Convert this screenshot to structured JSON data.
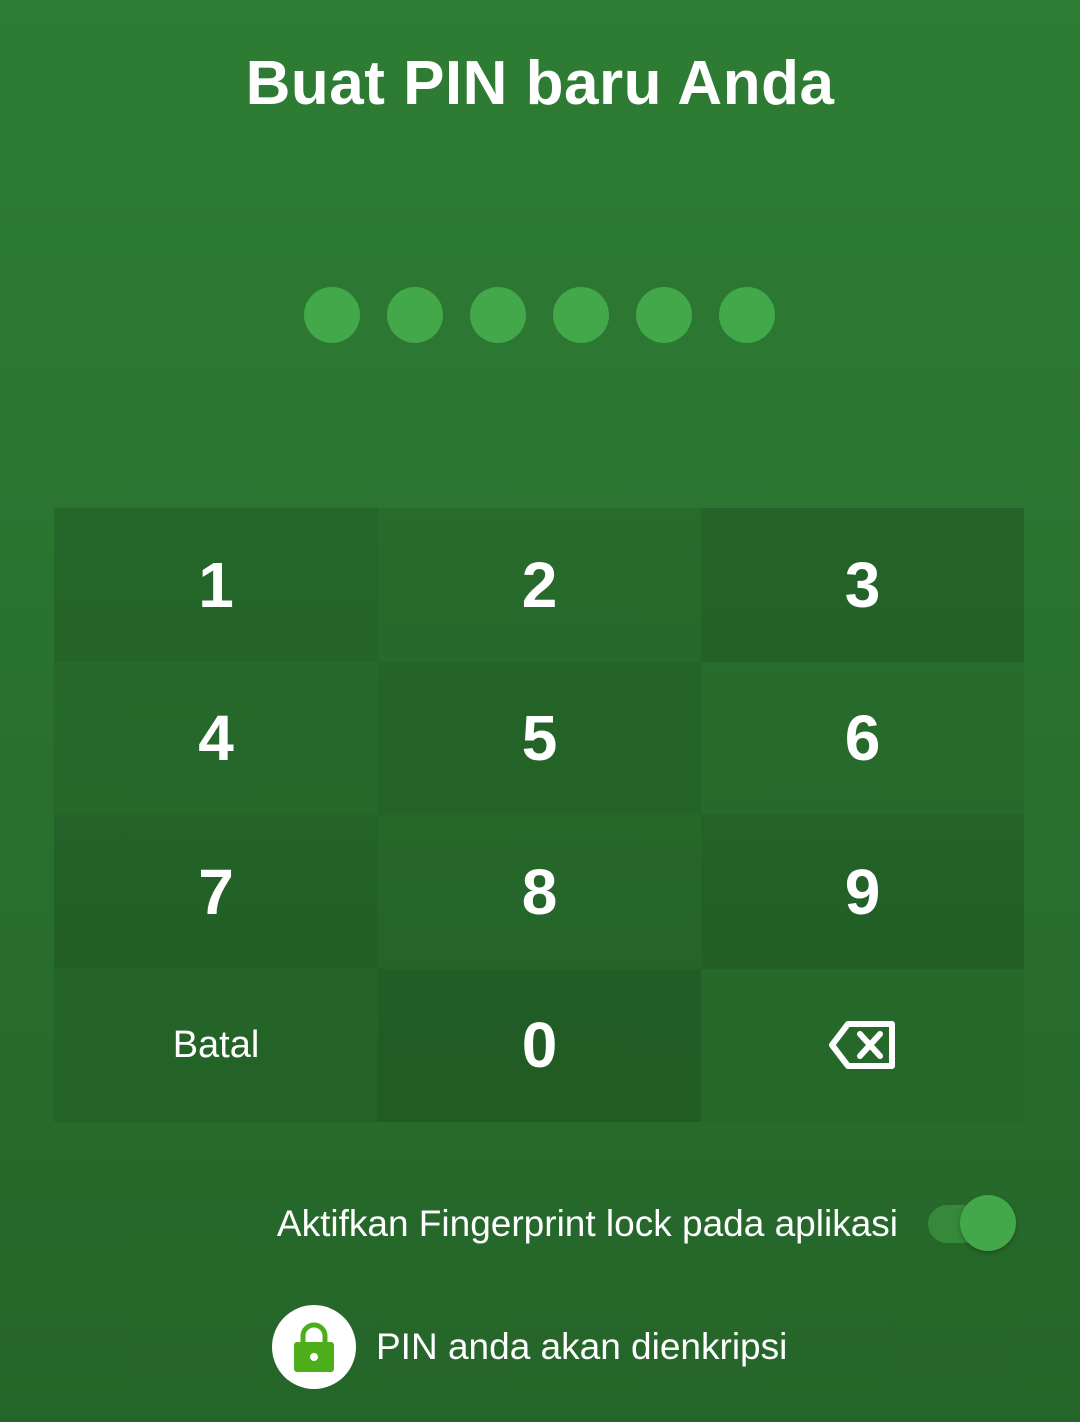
{
  "title": "Buat PIN baru Anda",
  "pin": {
    "length": 6,
    "filled": 0
  },
  "keypad": {
    "keys": [
      "1",
      "2",
      "3",
      "4",
      "5",
      "6",
      "7",
      "8",
      "9",
      "Batal",
      "0"
    ],
    "backspace_icon": "backspace-icon"
  },
  "fingerprint": {
    "label": "Aktifkan Fingerprint lock pada aplikasi",
    "enabled": true
  },
  "encryption": {
    "label": "PIN anda akan dienkripsi",
    "icon": "lock-icon"
  },
  "colors": {
    "background": "#2e7d34",
    "dot": "#43a84a",
    "toggle_thumb": "#43a84a",
    "lock_icon": "#4caf1a"
  }
}
